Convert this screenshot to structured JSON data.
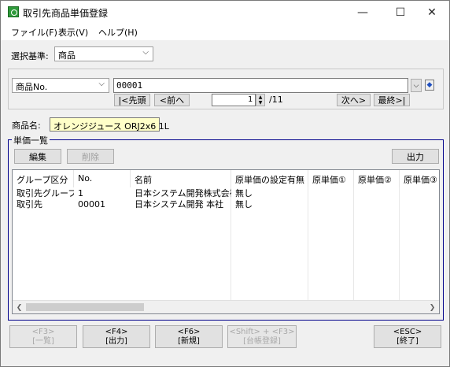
{
  "window": {
    "title": "取引先商品単価登録",
    "minimize": "—",
    "maximize": "☐",
    "close": "✕"
  },
  "menu": [
    "ファイル(F)",
    "表示(V)",
    "ヘルプ(H)"
  ],
  "criteria": {
    "label": "選択基準:",
    "value": "商品"
  },
  "search": {
    "field_select": "商品No.",
    "code_value": "00001",
    "first_label": "|<先頭",
    "prev_label": "<前へ",
    "page_value": "1",
    "page_total": "/11",
    "next_label": "次へ>",
    "last_label": "最終>|"
  },
  "product": {
    "label": "商品名:",
    "value": "オレンジジュース ORJ2x6 1L"
  },
  "group": {
    "title": "単価一覧",
    "edit_label": "編集",
    "delete_label": "削除",
    "output_label": "出力"
  },
  "table": {
    "columns": [
      "グループ区分",
      "No.",
      "名前",
      "原単価の設定有無",
      "原単価①",
      "原単価②",
      "原単価③"
    ],
    "rows": [
      [
        "取引先グループ",
        "1",
        "日本システム開発株式会社",
        "無し",
        "",
        "",
        ""
      ],
      [
        "取引先",
        "00001",
        "日本システム開発 本社",
        "無し",
        "",
        "",
        ""
      ]
    ]
  },
  "function_keys": [
    {
      "key": "<F3>",
      "name": "[一覧]",
      "enabled": false
    },
    {
      "key": "<F4>",
      "name": "[出力]",
      "enabled": true
    },
    {
      "key": "<F6>",
      "name": "[新規]",
      "enabled": true
    },
    {
      "key": "<Shift> + <F3>",
      "name": "[台帳登録]",
      "enabled": false
    },
    {
      "key": "<ESC>",
      "name": "[終了]",
      "enabled": true
    }
  ],
  "colors": {
    "title_icon": "#2e9a3a",
    "product_highlight": "#ffffc8",
    "groupbox_border": "#00008b",
    "search_icon": "#1f4fbf"
  }
}
